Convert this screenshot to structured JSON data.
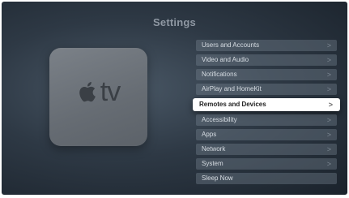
{
  "header": {
    "title": "Settings"
  },
  "device": {
    "logo_icon": "apple-logo-icon",
    "logo_text": "tv"
  },
  "menu": {
    "chevron_icon": "chevron-right-icon",
    "items": [
      {
        "label": "Users and Accounts",
        "chevron": ">"
      },
      {
        "label": "Video and Audio",
        "chevron": ">"
      },
      {
        "label": "Notifications",
        "chevron": ">"
      },
      {
        "label": "AirPlay and HomeKit",
        "chevron": ">"
      },
      {
        "label": "Remotes and Devices",
        "chevron": ">",
        "focused": true
      },
      {
        "label": "Accessibility",
        "chevron": ">"
      },
      {
        "label": "Apps",
        "chevron": ">"
      },
      {
        "label": "Network",
        "chevron": ">"
      },
      {
        "label": "System",
        "chevron": ">"
      },
      {
        "label": "Sleep Now"
      }
    ]
  },
  "colors": {
    "background": "#2e3945",
    "focused_item": "#ffffff",
    "item": "#5a6673"
  }
}
